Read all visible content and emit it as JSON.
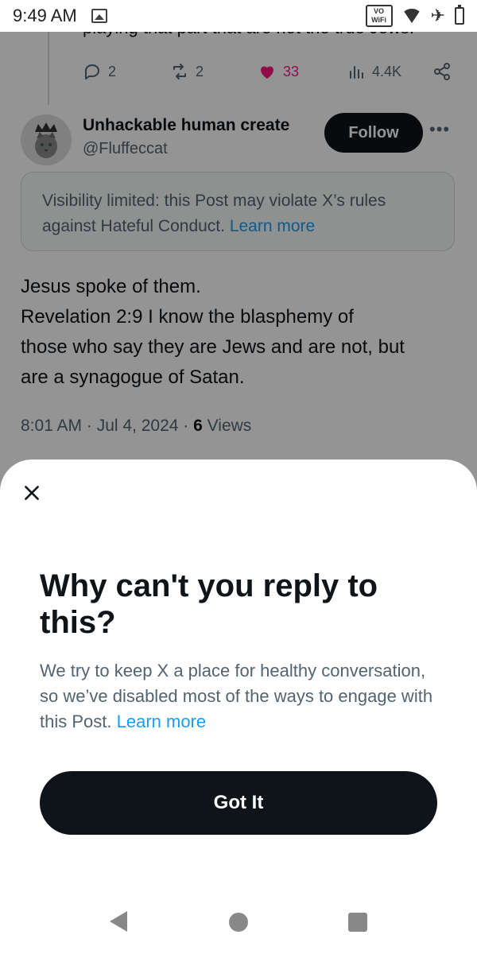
{
  "status_bar": {
    "time": "9:49 AM",
    "vowifi_top": "VO",
    "vowifi_bottom": "WiFi",
    "icons": [
      "gallery-icon",
      "vowifi-icon",
      "wifi-icon",
      "airplane-icon",
      "battery-icon"
    ]
  },
  "previous_post": {
    "partial_text": "playing that part that are not the true Jews.",
    "replies": "2",
    "reposts": "2",
    "likes": "33",
    "views": "4.4K",
    "like_color": "#f91880"
  },
  "post": {
    "display_name": "Unhackable human create",
    "handle": "@Fluffeccat",
    "follow_label": "Follow",
    "notice_text": "Visibility limited: this Post may violate X’s rules against Hateful Conduct.",
    "notice_link": "Learn more",
    "body_lines": [
      "Jesus spoke of them.",
      "Revelation 2:9  I know the blasphemy of",
      "those who say they are Jews and are not, but",
      "are a synagogue of Satan."
    ],
    "timestamp": "8:01 AM · Jul 4, 2024 · ",
    "views_count": "6",
    "views_label": " Views"
  },
  "sheet": {
    "title": "Why can't you reply to this?",
    "text": "We try to keep X a place for healthy conversation, so we’ve disabled most of the ways to engage with this Post.",
    "link": "Learn more",
    "button_label": "Got It"
  },
  "colors": {
    "link": "#1d9bf0",
    "text_primary": "#0f1419",
    "text_secondary": "#536471",
    "button_bg": "#0f1419"
  }
}
